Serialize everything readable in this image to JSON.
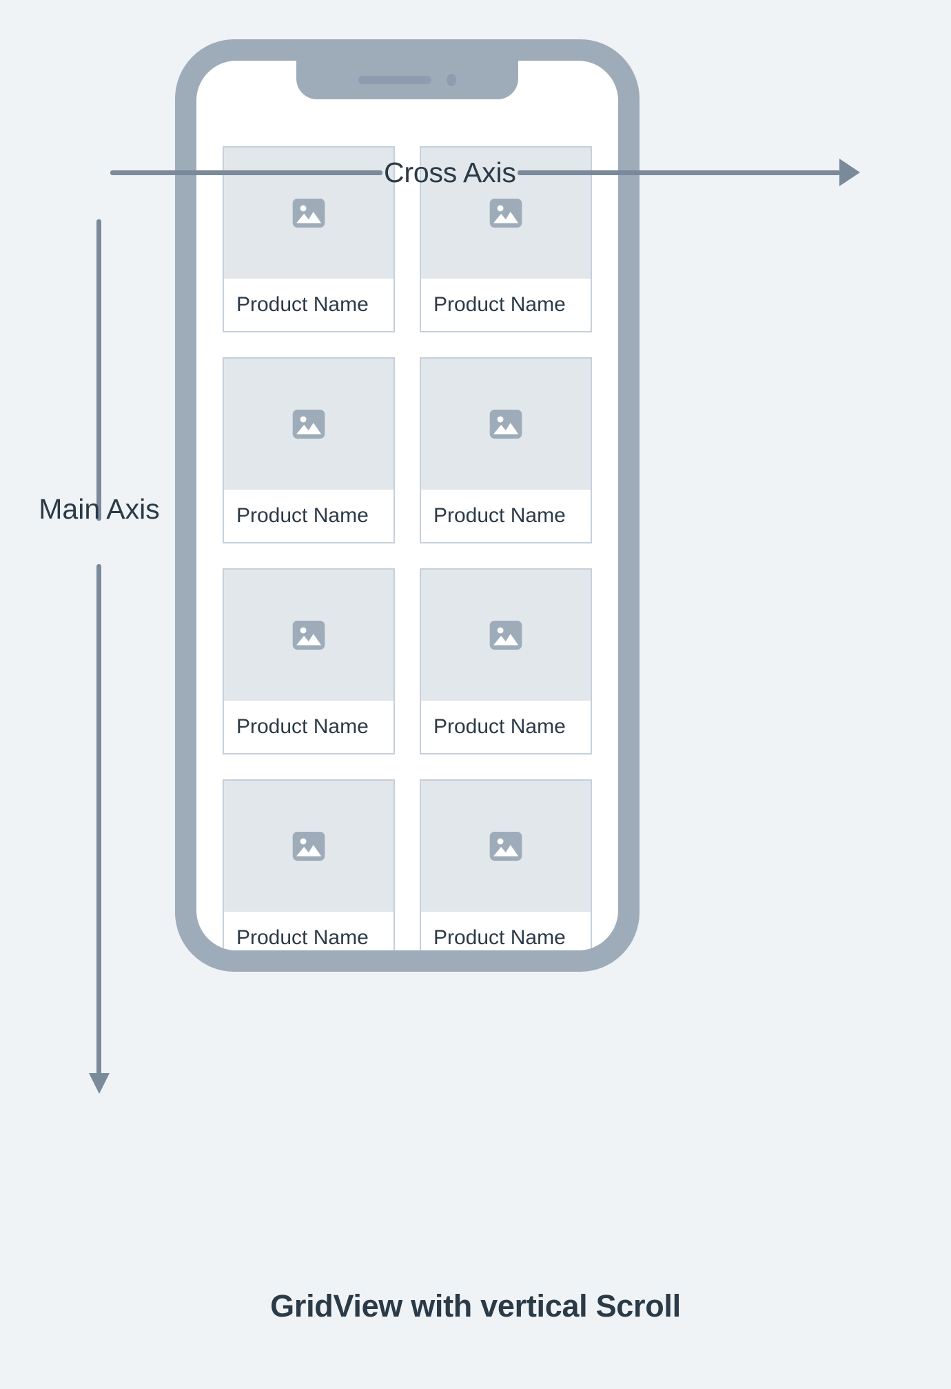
{
  "axes": {
    "cross": {
      "label": "Cross Axis",
      "direction": "horizontal-right",
      "arrow_color": "#7a8a9b",
      "label_color": "#2b3a47"
    },
    "main": {
      "label": "Main Axis",
      "direction": "vertical-down",
      "arrow_color": "#7a8a9b",
      "label_color": "#2b3a47"
    }
  },
  "phone": {
    "frame_color": "#9eacba",
    "screen_color": "#ffffff",
    "notch": {
      "speaker_name": "speaker-grille",
      "camera_name": "front-camera"
    }
  },
  "grid": {
    "columns": 2,
    "placeholder_icon": "image-placeholder-icon",
    "card_bg": "#ffffff",
    "card_border": "#c5d0da",
    "image_bg": "#e2e7eb",
    "icon_color": "#9eacba",
    "cards": [
      {
        "label": "Product Name"
      },
      {
        "label": "Product Name"
      },
      {
        "label": "Product Name"
      },
      {
        "label": "Product Name"
      },
      {
        "label": "Product Name"
      },
      {
        "label": "Product Name"
      },
      {
        "label": "Product Name"
      },
      {
        "label": "Product Name"
      }
    ]
  },
  "caption": {
    "text": "GridView with vertical Scroll",
    "color": "#2b3a47"
  },
  "page": {
    "background": "#eff3f6"
  }
}
